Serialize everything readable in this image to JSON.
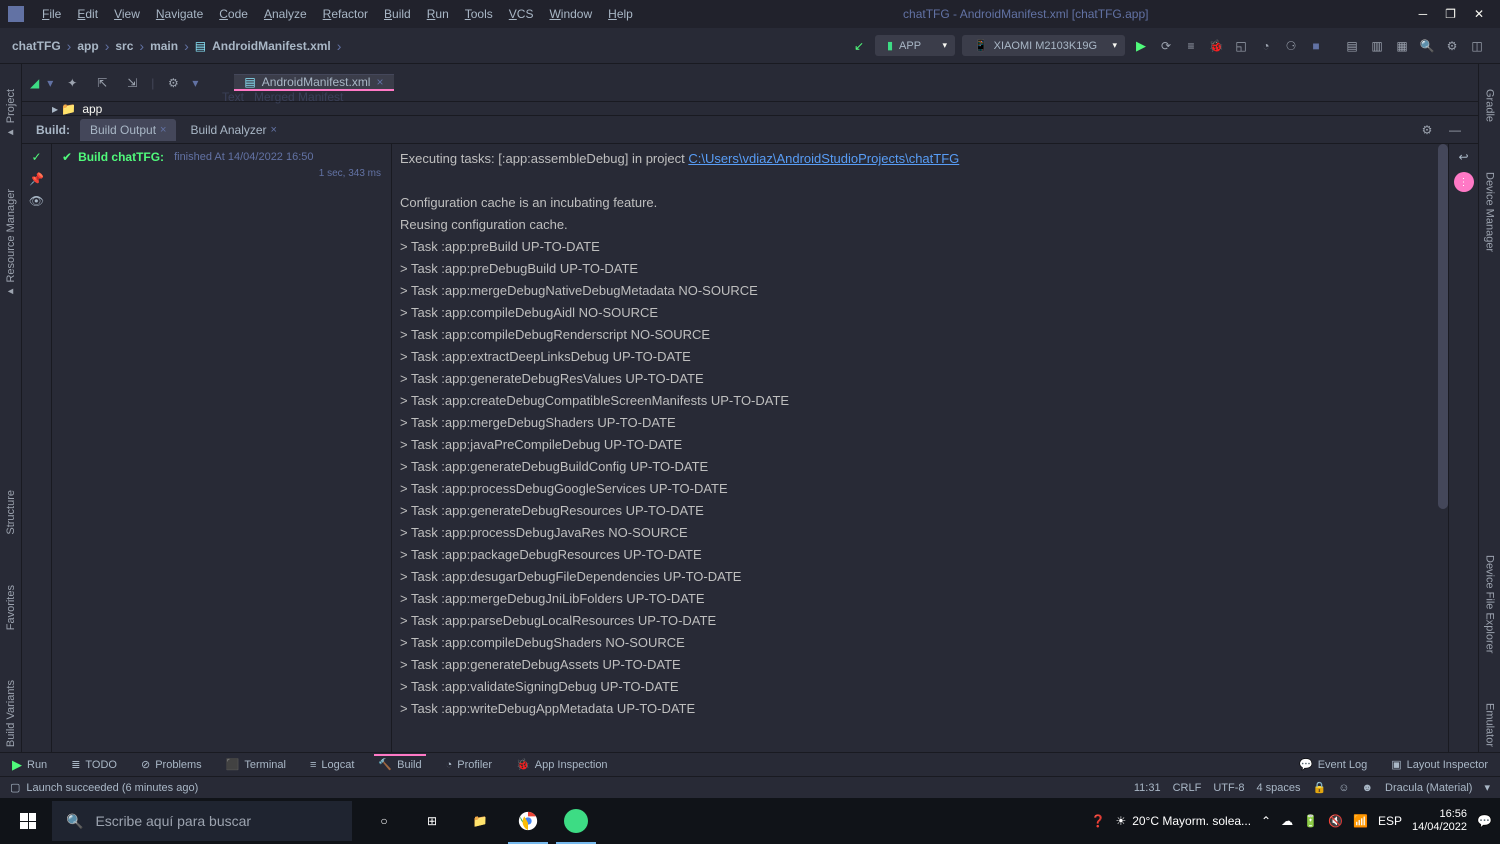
{
  "menubar": {
    "items": [
      "File",
      "Edit",
      "View",
      "Navigate",
      "Code",
      "Analyze",
      "Refactor",
      "Build",
      "Run",
      "Tools",
      "VCS",
      "Window",
      "Help"
    ],
    "window_title": "chatTFG - AndroidManifest.xml [chatTFG.app]"
  },
  "breadcrumb": {
    "items": [
      "chatTFG",
      "app",
      "src",
      "main",
      "AndroidManifest.xml"
    ]
  },
  "run_config": {
    "label": "APP"
  },
  "device": {
    "label": "XIAOMI M2103K19G"
  },
  "left_rails": [
    "Project",
    "Resource Manager"
  ],
  "left_rails_bottom": [
    "Structure",
    "Favorites",
    "Build Variants"
  ],
  "right_rails": [
    "Gradle",
    "Device Manager"
  ],
  "right_rails_bottom": [
    "Device File Explorer",
    "Emulator"
  ],
  "editor_tabs": [
    {
      "label": "AndroidManifest.xml"
    }
  ],
  "sub_tabs": [
    "Text",
    "Merged Manifest"
  ],
  "build": {
    "label": "Build:",
    "tabs": [
      {
        "label": "Build Output",
        "active": true
      },
      {
        "label": "Build Analyzer",
        "active": false
      }
    ],
    "tree": {
      "title": "Build chatTFG:",
      "status": "finished At 14/04/2022 16:50",
      "duration": "1 sec, 343 ms"
    },
    "output_prefix": "Executing tasks: [:app:assembleDebug] in project ",
    "output_link": "C:\\Users\\vdiaz\\AndroidStudioProjects\\chatTFG",
    "lines": [
      "",
      "Configuration cache is an incubating feature.",
      "Reusing configuration cache.",
      "> Task :app:preBuild UP-TO-DATE",
      "> Task :app:preDebugBuild UP-TO-DATE",
      "> Task :app:mergeDebugNativeDebugMetadata NO-SOURCE",
      "> Task :app:compileDebugAidl NO-SOURCE",
      "> Task :app:compileDebugRenderscript NO-SOURCE",
      "> Task :app:extractDeepLinksDebug UP-TO-DATE",
      "> Task :app:generateDebugResValues UP-TO-DATE",
      "> Task :app:createDebugCompatibleScreenManifests UP-TO-DATE",
      "> Task :app:mergeDebugShaders UP-TO-DATE",
      "> Task :app:javaPreCompileDebug UP-TO-DATE",
      "> Task :app:generateDebugBuildConfig UP-TO-DATE",
      "> Task :app:processDebugGoogleServices UP-TO-DATE",
      "> Task :app:generateDebugResources UP-TO-DATE",
      "> Task :app:processDebugJavaRes NO-SOURCE",
      "> Task :app:packageDebugResources UP-TO-DATE",
      "> Task :app:desugarDebugFileDependencies UP-TO-DATE",
      "> Task :app:mergeDebugJniLibFolders UP-TO-DATE",
      "> Task :app:parseDebugLocalResources UP-TO-DATE",
      "> Task :app:compileDebugShaders NO-SOURCE",
      "> Task :app:generateDebugAssets UP-TO-DATE",
      "> Task :app:validateSigningDebug UP-TO-DATE",
      "> Task :app:writeDebugAppMetadata UP-TO-DATE"
    ]
  },
  "bottom_tools": {
    "left": [
      "Run",
      "TODO",
      "Problems",
      "Terminal",
      "Logcat",
      "Build",
      "Profiler",
      "App Inspection"
    ],
    "right": [
      "Event Log",
      "Layout Inspector"
    ]
  },
  "status_bar": {
    "left": "Launch succeeded (6 minutes ago)",
    "pos": "11:31",
    "sep": "CRLF",
    "enc": "UTF-8",
    "indent": "4 spaces",
    "theme": "Dracula (Material)"
  },
  "taskbar": {
    "search_placeholder": "Escribe aquí para buscar",
    "weather": "20°C  Mayorm. solea...",
    "lang": "ESP",
    "time": "16:56",
    "date": "14/04/2022"
  }
}
